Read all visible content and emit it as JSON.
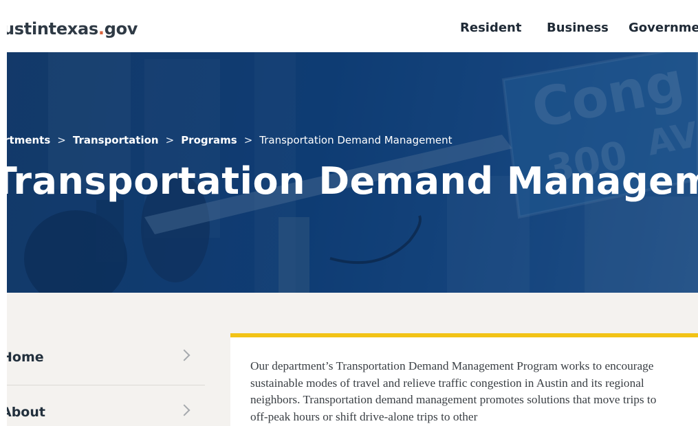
{
  "site": {
    "logo_main": "ustintexas",
    "logo_dot": ".",
    "logo_tld": "gov"
  },
  "nav": {
    "items": [
      "Resident",
      "Business",
      "Governme"
    ]
  },
  "hero": {
    "breadcrumb": [
      "artments",
      "Transportation",
      "Programs"
    ],
    "breadcrumb_separator": ">",
    "breadcrumb_current": "Transportation Demand Management",
    "title": "Transportation Demand Management",
    "sign_text": "Cong",
    "sign_number": "300",
    "sign_suffix": "AV"
  },
  "sidebar": {
    "items": [
      {
        "label": "Home"
      },
      {
        "label": "About"
      }
    ]
  },
  "content": {
    "intro": "Our department’s Transportation Demand Management Program works to encourage sustainable modes of travel and relieve traffic congestion in Austin and its regional neighbors. Transportation demand management promotes solutions that move trips to off-peak hours or shift drive-alone trips to other"
  },
  "colors": {
    "hero_blue": "#0f3e76",
    "accent_yellow": "#f2c316",
    "logo_dot": "#d9633d",
    "panel_bg": "#f4f2ef"
  }
}
